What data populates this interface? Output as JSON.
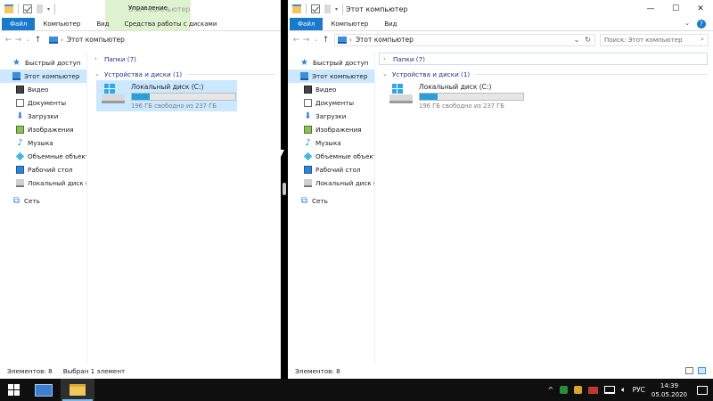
{
  "left": {
    "qat_drop": "▾",
    "title": "Этот компьютер",
    "manage_label": "Управление",
    "tabs": [
      "Файл",
      "Компьютер",
      "Вид",
      "Средства работы с дисками"
    ],
    "address": "Этот компьютер",
    "nav": [
      "Быстрый доступ",
      "Этот компьютер",
      "Видео",
      "Документы",
      "Загрузки",
      "Изображения",
      "Музыка",
      "Объемные объекты",
      "Рабочий стол",
      "Локальный диск (C:)",
      "Сеть"
    ],
    "groups": [
      {
        "label": "Папки (7)",
        "arrow": "›"
      },
      {
        "label": "Устройства и диски (1)",
        "arrow": "⌄"
      }
    ],
    "drive": {
      "name": "Локальный диск (C:)",
      "free": "196 ГБ свободно из 237 ГБ",
      "used_fraction": 0.17
    },
    "status_count": "Элементов: 8",
    "status_selected": "Выбран 1 элемент"
  },
  "right": {
    "qat_drop": "▾",
    "title": "Этот компьютер",
    "tabs": [
      "Файл",
      "Компьютер",
      "Вид"
    ],
    "window_controls": [
      "—",
      "☐",
      "✕"
    ],
    "help": "?",
    "address": "Этот компьютер",
    "search_placeholder": "Поиск: Этот компьютер",
    "nav": [
      "Быстрый доступ",
      "Этот компьютер",
      "Видео",
      "Документы",
      "Загрузки",
      "Изображения",
      "Музыка",
      "Объемные объекты",
      "Рабочий стол",
      "Локальный диск (C:)",
      "Сеть"
    ],
    "groups": [
      {
        "label": "Папки (7)",
        "arrow": "›"
      },
      {
        "label": "Устройства и диски (1)",
        "arrow": "⌄"
      }
    ],
    "drive": {
      "name": "Локальный диск (C:)",
      "free": "196 ГБ свободно из 237 ГБ",
      "used_fraction": 0.17
    },
    "status_count": "Элементов: 8"
  },
  "taskbar": {
    "language": "РУС",
    "time": "14:39",
    "date": "05.05.2020"
  },
  "colors": {
    "accent": "#1979ca",
    "selection": "#cce8ff",
    "manage_tab": "#dff2d0",
    "bar_fill": "#26a0da"
  }
}
